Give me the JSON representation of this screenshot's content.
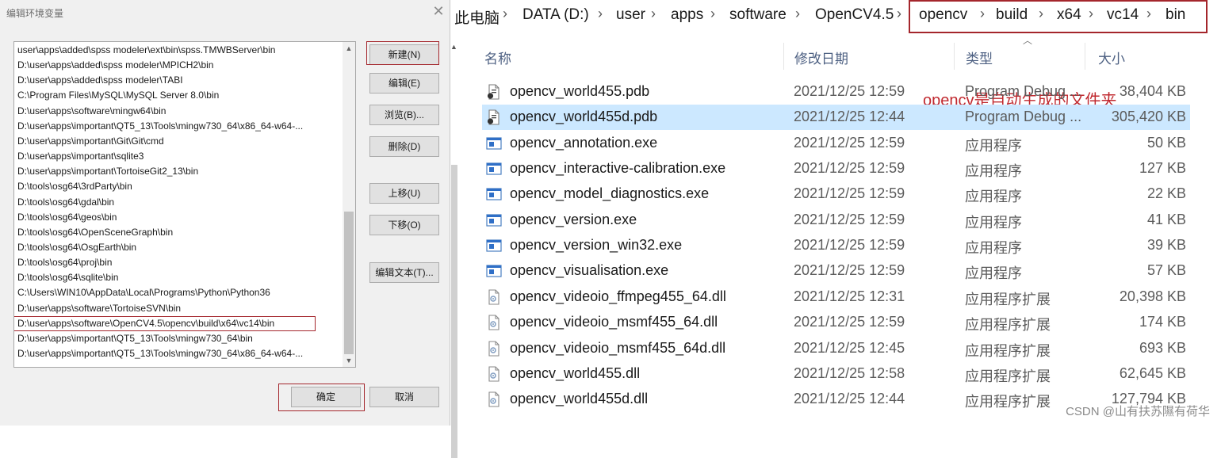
{
  "dialog": {
    "title": "编辑环境变量",
    "close_glyph": "✕",
    "path_list": [
      "user\\apps\\added\\spss modeler\\ext\\bin\\spss.TMWBServer\\bin",
      "D:\\user\\apps\\added\\spss modeler\\MPICH2\\bin",
      "D:\\user\\apps\\added\\spss modeler\\TABI",
      "C:\\Program Files\\MySQL\\MySQL Server 8.0\\bin",
      "D:\\user\\apps\\software\\mingw64\\bin",
      "D:\\user\\apps\\important\\QT5_13\\Tools\\mingw730_64\\x86_64-w64-...",
      "D:\\user\\apps\\important\\Git\\Git\\cmd",
      "D:\\user\\apps\\important\\sqlite3",
      "D:\\user\\apps\\important\\TortoiseGit2_13\\bin",
      "D:\\tools\\osg64\\3rdParty\\bin",
      "D:\\tools\\osg64\\gdal\\bin",
      "D:\\tools\\osg64\\geos\\bin",
      "D:\\tools\\osg64\\OpenSceneGraph\\bin",
      "D:\\tools\\osg64\\OsgEarth\\bin",
      "D:\\tools\\osg64\\proj\\bin",
      "D:\\tools\\osg64\\sqlite\\bin",
      "C:\\Users\\WIN10\\AppData\\Local\\Programs\\Python\\Python36",
      "D:\\user\\apps\\software\\TortoiseSVN\\bin",
      "D:\\user\\apps\\software\\OpenCV4.5\\opencv\\build\\x64\\vc14\\bin",
      "D:\\user\\apps\\important\\QT5_13\\Tools\\mingw730_64\\bin",
      "D:\\user\\apps\\important\\QT5_13\\Tools\\mingw730_64\\x86_64-w64-..."
    ],
    "selected_index": 18,
    "buttons": {
      "new": "新建(N)",
      "edit": "编辑(E)",
      "browse": "浏览(B)...",
      "delete": "删除(D)",
      "move_up": "上移(U)",
      "move_down": "下移(O)",
      "edit_text": "编辑文本(T)...",
      "ok": "确定",
      "cancel": "取消"
    }
  },
  "explorer": {
    "breadcrumb": [
      "此电脑",
      "DATA (D:)",
      "user",
      "apps",
      "software",
      "OpenCV4.5",
      "opencv",
      "build",
      "x64",
      "vc14",
      "bin"
    ],
    "columns": {
      "name": "名称",
      "date": "修改日期",
      "type": "类型",
      "size": "大小"
    },
    "annotation": "opencv是自动生成的文件夹",
    "selected_index": 1,
    "files": [
      {
        "name": "opencv_world455.pdb",
        "date": "2021/12/25 12:59",
        "type": "Program Debug ...",
        "size": "38,404 KB",
        "icon": "pdb-file-icon"
      },
      {
        "name": "opencv_world455d.pdb",
        "date": "2021/12/25 12:44",
        "type": "Program Debug ...",
        "size": "305,420 KB",
        "icon": "pdb-file-icon"
      },
      {
        "name": "opencv_annotation.exe",
        "date": "2021/12/25 12:59",
        "type": "应用程序",
        "size": "50 KB",
        "icon": "exe-file-icon"
      },
      {
        "name": "opencv_interactive-calibration.exe",
        "date": "2021/12/25 12:59",
        "type": "应用程序",
        "size": "127 KB",
        "icon": "exe-file-icon"
      },
      {
        "name": "opencv_model_diagnostics.exe",
        "date": "2021/12/25 12:59",
        "type": "应用程序",
        "size": "22 KB",
        "icon": "exe-file-icon"
      },
      {
        "name": "opencv_version.exe",
        "date": "2021/12/25 12:59",
        "type": "应用程序",
        "size": "41 KB",
        "icon": "exe-file-icon"
      },
      {
        "name": "opencv_version_win32.exe",
        "date": "2021/12/25 12:59",
        "type": "应用程序",
        "size": "39 KB",
        "icon": "exe-file-icon"
      },
      {
        "name": "opencv_visualisation.exe",
        "date": "2021/12/25 12:59",
        "type": "应用程序",
        "size": "57 KB",
        "icon": "exe-file-icon"
      },
      {
        "name": "opencv_videoio_ffmpeg455_64.dll",
        "date": "2021/12/25 12:31",
        "type": "应用程序扩展",
        "size": "20,398 KB",
        "icon": "dll-file-icon"
      },
      {
        "name": "opencv_videoio_msmf455_64.dll",
        "date": "2021/12/25 12:59",
        "type": "应用程序扩展",
        "size": "174 KB",
        "icon": "dll-file-icon"
      },
      {
        "name": "opencv_videoio_msmf455_64d.dll",
        "date": "2021/12/25 12:45",
        "type": "应用程序扩展",
        "size": "693 KB",
        "icon": "dll-file-icon"
      },
      {
        "name": "opencv_world455.dll",
        "date": "2021/12/25 12:58",
        "type": "应用程序扩展",
        "size": "62,645 KB",
        "icon": "dll-file-icon"
      },
      {
        "name": "opencv_world455d.dll",
        "date": "2021/12/25 12:44",
        "type": "应用程序扩展",
        "size": "127,794 KB",
        "icon": "dll-file-icon"
      }
    ]
  },
  "watermark": "CSDN @山有扶苏隰有荷华",
  "colors": {
    "highlight": "#a4262c",
    "selection": "#cce8ff",
    "annotation": "#c0292f"
  }
}
